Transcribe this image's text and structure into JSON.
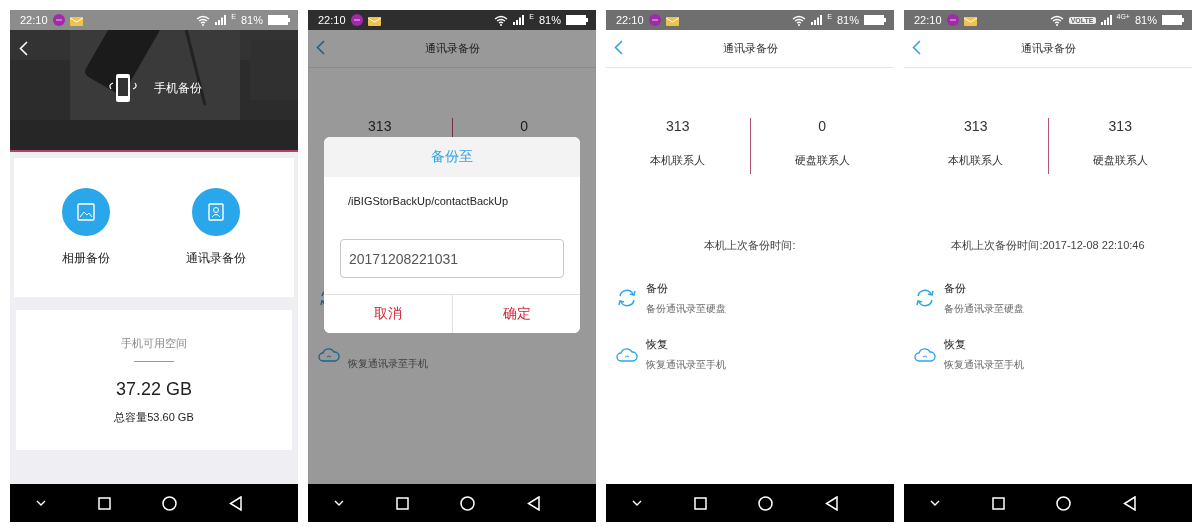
{
  "screens": [
    {
      "kind": "home",
      "dimmed": false,
      "status_bar": {
        "time": "22:10",
        "network": "E",
        "battery": "81%"
      },
      "header": {
        "title": "手机备份"
      },
      "shortcuts": [
        {
          "kind": "album",
          "label": "相册备份"
        },
        {
          "kind": "contacts",
          "label": "通讯录备份"
        }
      ],
      "storage": {
        "label": "手机可用空间",
        "free": "37.22 GB",
        "total": "总容量53.60 GB"
      }
    },
    {
      "kind": "contacts",
      "dimmed": true,
      "status_bar": {
        "time": "22:10",
        "network": "E",
        "battery": "81%"
      },
      "title": "通讯录备份",
      "stats": [
        {
          "count": "313"
        },
        {
          "count": "0"
        }
      ],
      "actions": [
        {
          "kind": "backup"
        },
        {
          "kind": "restore",
          "subtitle": "恢复通讯录至手机"
        }
      ],
      "dialog": {
        "title": "备份至",
        "path": "/iBIGStorBackUp/contactBackUp",
        "value": "20171208221031",
        "buttons": [
          "取消",
          "确定"
        ]
      }
    },
    {
      "kind": "contacts",
      "dimmed": false,
      "status_bar": {
        "time": "22:10",
        "network": "E",
        "battery": "81%"
      },
      "title": "通讯录备份",
      "stats": [
        {
          "count": "313",
          "label": "本机联系人"
        },
        {
          "count": "0",
          "label": "硬盘联系人"
        }
      ],
      "last_backup": "本机上次备份时间:",
      "actions": [
        {
          "kind": "backup",
          "title": "备份",
          "subtitle": "备份通讯录至硬盘"
        },
        {
          "kind": "restore",
          "title": "恢复",
          "subtitle": "恢复通讯录至手机"
        }
      ]
    },
    {
      "kind": "contacts",
      "dimmed": false,
      "status_bar": {
        "time": "22:10",
        "volte": "VOLTE",
        "network": "4G+",
        "battery": "81%"
      },
      "title": "通讯录备份",
      "stats": [
        {
          "count": "313",
          "label": "本机联系人"
        },
        {
          "count": "313",
          "label": "硬盘联系人"
        }
      ],
      "last_backup": "本机上次备份时间:2017-12-08 22:10:46",
      "actions": [
        {
          "kind": "backup",
          "title": "备份",
          "subtitle": "备份通讯录至硬盘"
        },
        {
          "kind": "restore",
          "title": "恢复",
          "subtitle": "恢复通讯录至手机"
        }
      ]
    }
  ]
}
